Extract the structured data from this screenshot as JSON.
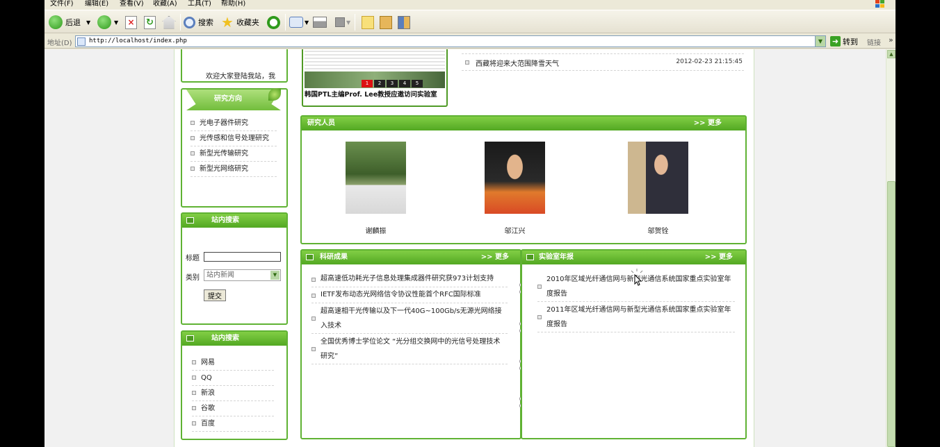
{
  "menu": [
    "文件(F)",
    "编辑(E)",
    "查看(V)",
    "收藏(A)",
    "工具(T)",
    "帮助(H)"
  ],
  "toolbar": {
    "back": "后退",
    "search": "搜索",
    "favorites": "收藏夹"
  },
  "address": {
    "label": "地址(D)",
    "url": "http://localhost/index.php",
    "go": "转到",
    "links": "链接"
  },
  "welcome": "欢迎大家登陆我站，我",
  "slideshow": {
    "caption": "韩国PTL主编Prof. Lee教授应邀访问实验室",
    "pages": [
      "1",
      "2",
      "3",
      "4",
      "5"
    ]
  },
  "top_news": {
    "title": "西藏将迎来大范围降雪天气",
    "date": "2012-02-23 21:15:45"
  },
  "research": {
    "title": "研究方向",
    "items": [
      "光电子器件研究",
      "光传感和信号处理研究",
      "新型光传输研究",
      "新型光网络研究"
    ]
  },
  "site_search": {
    "title": "站内搜索",
    "field_label": "标题",
    "category_label": "类别",
    "category_value": "站内新闻",
    "submit": "提交"
  },
  "links_box": {
    "title": "站内搜索",
    "items": [
      "网易",
      "QQ",
      "新浪",
      "谷歌",
      "百度"
    ]
  },
  "people": {
    "title": "研究人员",
    "more": ">> 更多",
    "members": [
      {
        "name": "谢麟振"
      },
      {
        "name": "邬江兴"
      },
      {
        "name": "邬贺铨"
      }
    ]
  },
  "achievements": {
    "title": "科研成果",
    "more": ">> 更多",
    "items": [
      "超高速低功耗光子信息处理集成器件研究获973计划支持",
      "IETF发布动态光网络信令协议性能首个RFC国际标准",
      "超高速相干光传输以及下一代40G~100Gb/s无源光网络接入技术",
      "全国优秀博士学位论文 “光分组交换网中的光信号处理技术研究”"
    ]
  },
  "annual": {
    "title": "实验室年报",
    "more": ">> 更多",
    "items": [
      "2010年区域光纤通信网与新型光通信系统国家重点实验室年度报告",
      "2011年区域光纤通信网与新型光通信系统国家重点实验室年度报告"
    ]
  },
  "colors": {
    "panel_green": "#5fb233",
    "header_light": "#82ce45",
    "header_dark": "#52a822"
  }
}
